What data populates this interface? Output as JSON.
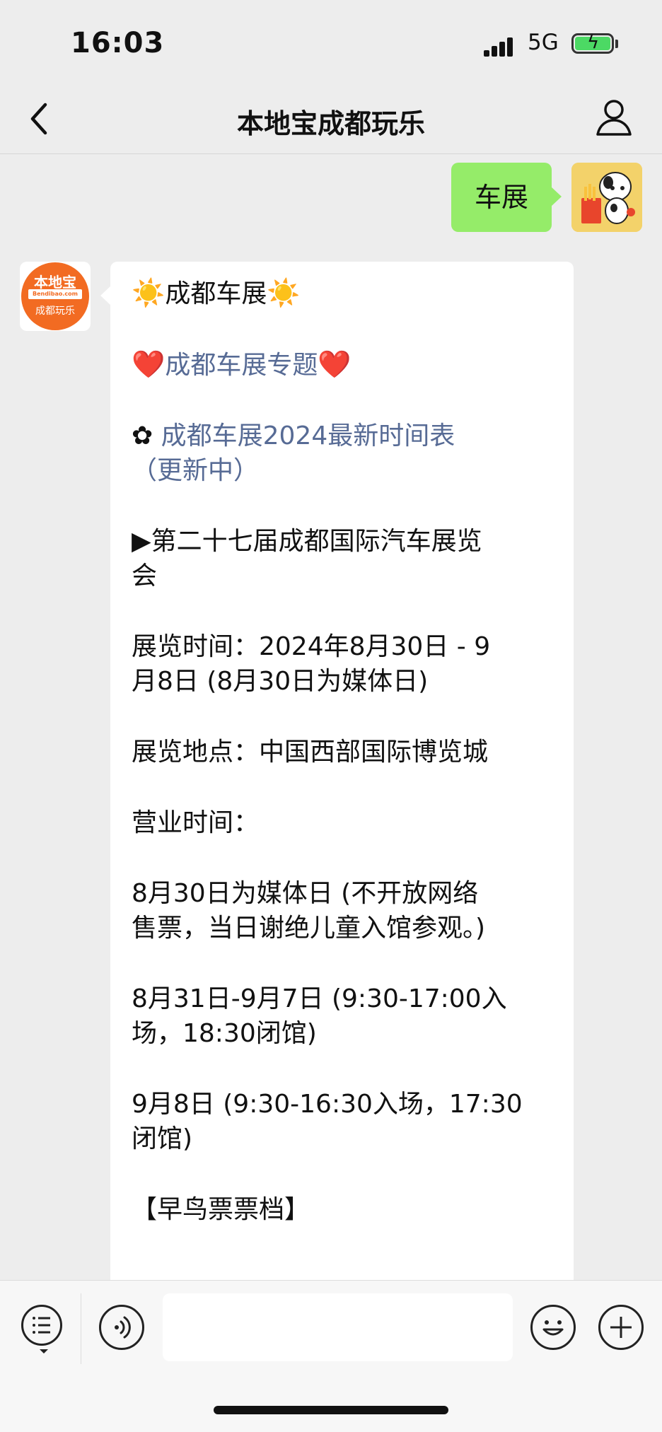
{
  "status_bar": {
    "time": "16:03",
    "network": "5G",
    "battery_fill": 1.0,
    "battery_color": "#4cd964"
  },
  "nav": {
    "title": "本地宝成都玩乐",
    "back_icon": "chevron-left-icon",
    "profile_icon": "person-icon"
  },
  "chat": {
    "user_message": "车展",
    "user_bubble_color": "#95ec69",
    "bot_avatar": {
      "logo_text": "本地宝",
      "logo_band": "Bendibao.com",
      "logo_name": "成都玩乐",
      "color": "#f26b22"
    },
    "bot_message": {
      "line1_emoji_left": "☀️",
      "line1_text": "成都车展",
      "line1_emoji_right": "☀️",
      "line2_emoji_left": "❤️",
      "line2_link": "成都车展专题",
      "line2_emoji_right": "❤️",
      "line3_icon": "✿",
      "line3_link_a": "成都车展2024最新时间表",
      "line3_link_b": "（更新中）",
      "line4_a": "▶第二十七届成都国际汽车展览",
      "line4_b": "会",
      "line5_a": "展览时间：2024年8月30日 - 9",
      "line5_b": "月8日 (8月30日为媒体日)",
      "line6": "展览地点：中国西部国际博览城",
      "line7": "营业时间：",
      "line8_a": "8月30日为媒体日 (不开放网络",
      "line8_b": "售票，当日谢绝儿童入馆参观。)",
      "line9_a": "8月31日-9月7日 (9:30-17:00入",
      "line9_b": "场，18:30闭馆)",
      "line10_a": "9月8日 (9:30-16:30入场，17:30",
      "line10_b": "闭馆)",
      "line11": "【早鸟票票档】"
    },
    "link_color": "#576b95"
  },
  "input_bar": {
    "menu_icon": "list-menu-icon",
    "voice_icon": "voice-icon",
    "emoji_icon": "smile-icon",
    "plus_icon": "plus-icon",
    "input_value": ""
  }
}
